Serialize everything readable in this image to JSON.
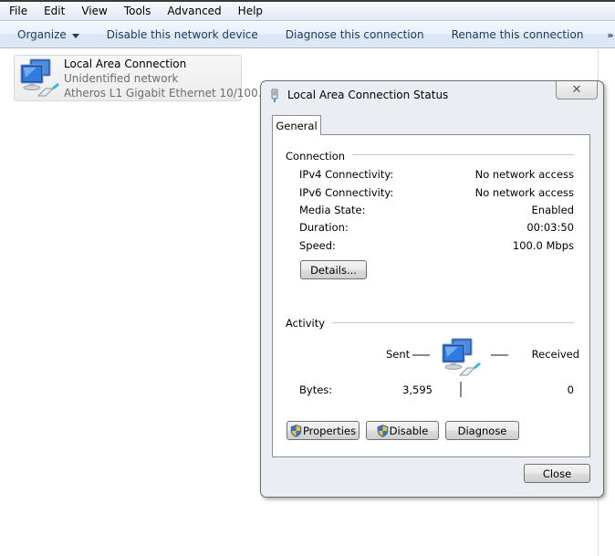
{
  "menubar": {
    "items": [
      "File",
      "Edit",
      "View",
      "Tools",
      "Advanced",
      "Help"
    ]
  },
  "toolbar": {
    "organize_label": "Organize",
    "disable_label": "Disable this network device",
    "diagnose_label": "Diagnose this connection",
    "rename_label": "Rename this connection",
    "more_label": "»"
  },
  "connection_tile": {
    "name": "Local Area Connection",
    "status": "Unidentified network",
    "device": "Atheros L1 Gigabit Ethernet 10/100..."
  },
  "dialog": {
    "title": "Local Area Connection Status",
    "close_glyph": "✕",
    "tab_label": "General",
    "connection": {
      "title": "Connection",
      "rows": [
        {
          "label": "IPv4 Connectivity:",
          "value": "No network access"
        },
        {
          "label": "IPv6 Connectivity:",
          "value": "No network access"
        },
        {
          "label": "Media State:",
          "value": "Enabled"
        },
        {
          "label": "Duration:",
          "value": "00:03:50"
        },
        {
          "label": "Speed:",
          "value": "100.0 Mbps"
        }
      ],
      "details_label": "Details..."
    },
    "activity": {
      "title": "Activity",
      "sent_label": "Sent",
      "received_label": "Received",
      "bytes_label": "Bytes:",
      "bytes_sent": "3,595",
      "bytes_received": "0"
    },
    "buttons": {
      "properties": "Properties",
      "disable": "Disable",
      "diagnose": "Diagnose",
      "close": "Close"
    }
  }
}
